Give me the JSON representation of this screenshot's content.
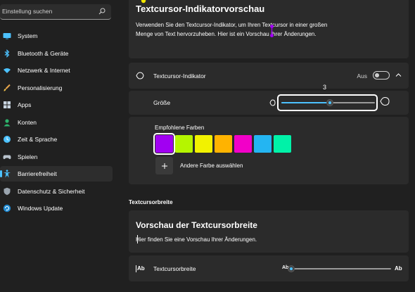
{
  "sidebar": {
    "search_placeholder": "Einstellung suchen",
    "items": [
      {
        "label": "System",
        "icon": "monitor-icon",
        "active": false
      },
      {
        "label": "Bluetooth & Geräte",
        "icon": "bluetooth-icon",
        "active": false
      },
      {
        "label": "Netzwerk & Internet",
        "icon": "wifi-icon",
        "active": false
      },
      {
        "label": "Personalisierung",
        "icon": "brush-icon",
        "active": false
      },
      {
        "label": "Apps",
        "icon": "apps-icon",
        "active": false
      },
      {
        "label": "Konten",
        "icon": "person-icon",
        "active": false
      },
      {
        "label": "Zeit & Sprache",
        "icon": "globe-clock-icon",
        "active": false
      },
      {
        "label": "Spielen",
        "icon": "gamepad-icon",
        "active": false
      },
      {
        "label": "Barrierefreiheit",
        "icon": "accessibility-icon",
        "active": true
      },
      {
        "label": "Datenschutz & Sicherheit",
        "icon": "shield-icon",
        "active": false
      },
      {
        "label": "Windows Update",
        "icon": "update-icon",
        "active": false
      }
    ]
  },
  "preview": {
    "title": "Textcursor-Indikatorvorschau",
    "text": "Verwenden Sie den Textcursor-Indikator, um Ihren Textcursor in einer großen Menge von Text hervorzuheben. Hier ist ein Vorschau Ihrer Änderungen."
  },
  "indicator": {
    "label": "Textcursor-Indikator",
    "toggle_label": "Aus",
    "toggle_on": false
  },
  "size": {
    "label": "Größe",
    "value": "3",
    "fraction": 0.52
  },
  "colors": {
    "label": "Empfohlene Farben",
    "swatches": [
      "#a100f2",
      "#b5f500",
      "#f2f200",
      "#ffb300",
      "#f200c8",
      "#24b5f2",
      "#00f2a8"
    ],
    "selected_index": 0,
    "add_label": "Andere Farbe auswählen"
  },
  "width_section": {
    "heading": "Textcursorbreite",
    "preview_title": "Vorschau der Textcursorbreite",
    "preview_text": "Hier finden Sie eine Vorschau Ihrer Änderungen.",
    "label": "Textcursorbreite",
    "icon_text": "Ab",
    "fraction": 0.0
  },
  "accent_color": "#4cc2ff"
}
